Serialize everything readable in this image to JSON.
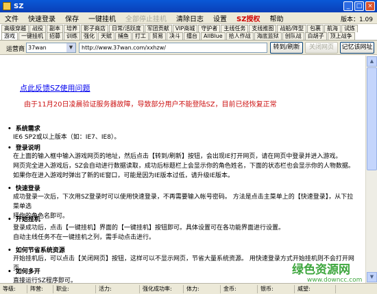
{
  "window": {
    "title": "SZ"
  },
  "menu": {
    "items": [
      "文件",
      "快速登录",
      "保存",
      "一键挂机",
      "全部停止挂机",
      "清除日志",
      "设置",
      "SZ授权",
      "帮助"
    ],
    "version": "版本：1.09"
  },
  "tabs": {
    "row1": [
      "高级穿越",
      "战役",
      "副本",
      "培养",
      "影子商店",
      "日常/活跃度",
      "军团贡献",
      "VIP商城",
      "守护者",
      "主线任务",
      "支线推图",
      "战船/阵型",
      "包裹",
      "航海",
      "试炼"
    ],
    "row2": [
      "游戏",
      "一键挂机",
      "招募",
      "训练",
      "强化",
      "天赋",
      "捕鱼",
      "打工",
      "贸易",
      "决斗",
      "擂台",
      "AllBlue",
      "拾人作战",
      "海底监狱",
      "创队战",
      "白胡子",
      "顶上战争"
    ]
  },
  "address": {
    "label": "运营商",
    "operator": "37wan",
    "url": "http://www.37wan.com/xxhzw/",
    "goto_btn": "转到/刷新",
    "close_btn": "关闭网页",
    "remember_btn": "记忆该网址"
  },
  "content": {
    "feedback_link": "点此反馈SZ使用问题",
    "notice": "由于11月20日凌晨验证服务器故障，导致部分用户不能登陆SZ，目前已经恢复正常",
    "sections": [
      {
        "heading": "系统需求",
        "lines": [
          "IE6 SP2或以上版本（如：IE7、IE8）。"
        ]
      },
      {
        "heading": "登录说明",
        "lines": [
          "在上面的输入框中输入游戏网页的地址，然后点击【转到/刷新】按钮，会出现IE打开网页，请在网页中登录并进入游戏。",
          "网页完全进入游戏后，SZ会自动进行数据读取，成功后标题栏上会显示你的角色姓名，下面的状态栏也会显示你的人物数据。",
          "如果你在进入游戏时弹出了新的IE窗口，可能是因为IE版本过低，请升级IE版本。"
        ]
      },
      {
        "heading": "快速登录",
        "lines": [
          "成功登录一次后，下次用SZ登录时可以使用快速登录，不再需要输入帐号密码。 方法是点击主菜单上的【快速登录】，从下拉菜单选",
          "择你的角色名即可。"
        ]
      },
      {
        "heading": "开始挂机",
        "lines": [
          "登录成功后，点击【一键挂机】界面的【一键挂机】按钮即可。具体设置可在各功能界面进行设置。",
          "自动主线任务不在一键挂机之列，需手动点击进行。"
        ]
      },
      {
        "heading": "如何节省系统资源",
        "lines": [
          "开始挂机后，可以点击【关闭网页】按钮，这样可以不显示网页，节省大量系统资源。 用快速登录方式开始挂机则不会打开网页。"
        ]
      },
      {
        "heading": "如何多开",
        "lines": [
          "直接运行SZ程序即可。"
        ]
      }
    ]
  },
  "status": [
    "等级:",
    "阵营:",
    "职业:",
    "活力:",
    "强化成功率:",
    "体力:",
    "金币:",
    "银币:",
    "威望:"
  ],
  "watermark": {
    "title": "绿色资源网",
    "url": "www.downcc.com"
  }
}
